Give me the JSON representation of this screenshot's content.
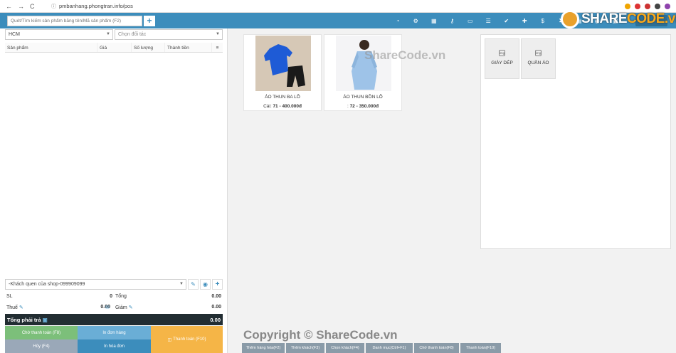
{
  "browser": {
    "url": "pmbanhang.phongtran.info/pos",
    "nav_back": "←",
    "nav_forward": "→",
    "nav_reload": "C",
    "lock": "ⓘ"
  },
  "toolbar": {
    "search_placeholder": "Quét/Tìm kiếm sản phẩm bằng tên/Mã sản phẩm (F2)",
    "add_label": "+",
    "icons": [
      "dashboard-icon",
      "share-icon",
      "calculator-icon",
      "key-icon",
      "laptop-icon",
      "list-icon",
      "check-circle-icon",
      "plus-circle-icon",
      "dollar-icon",
      "hourglass-icon",
      "calendar-icon",
      "bell-icon",
      "folder-icon"
    ],
    "icon_glyphs": [
      "◔",
      "⚙",
      "▦",
      "⚷",
      "▭",
      "☰",
      "✔",
      "✚",
      "$",
      "⧗",
      "▤",
      "◉",
      "▣"
    ]
  },
  "left": {
    "location_select": "HCM",
    "partner_select": "Chọn đối tác",
    "table_headers": [
      "Sản phẩm",
      "Giá",
      "Số lượng",
      "Thành tiền",
      "≡"
    ],
    "customer_select": "-Khách quen của shop-099909099",
    "customer_buttons": [
      "✎",
      "◉",
      "+"
    ],
    "summary": {
      "qty_label": "SL",
      "qty_value": "0",
      "subtotal_label": "Tổng",
      "subtotal_value": "0.00",
      "tax_label": "Thuế",
      "tax_value": "0.00",
      "discount_label": "Giảm",
      "discount_value": "0.00",
      "edit_glyph": "✎",
      "comment_glyph": "✉"
    },
    "total": {
      "label": "Tổng phải trả",
      "value": "0.00",
      "icon": "▣"
    },
    "actions": {
      "partial_pay": "Chờ thanh toán (F8)",
      "print_order": "In đơn hàng",
      "pay": "Thanh toán (F10)",
      "pay_icon": "◫",
      "cancel": "Hủy (F4)",
      "print_invoice": "In hóa đơn"
    },
    "colors": {
      "partial_pay": "#7cbf7a",
      "print_order": "#6aaed6",
      "pay": "#f5b547",
      "cancel": "#9aa8b8",
      "print_invoice": "#3c8dbc"
    }
  },
  "products": [
    {
      "name": "ÁO THUN BA LỖ",
      "price_prefix": "Cái:",
      "price_value": "71 - 400.000đ"
    },
    {
      "name": "ÁO THUN BỒN LỖ",
      "price_prefix": ":",
      "price_value": "72 - 350.000đ"
    }
  ],
  "categories": [
    {
      "name": "GIÀY DÉP",
      "icon": "img"
    },
    {
      "name": "QUẦN ÁO",
      "icon": "img"
    }
  ],
  "bottom_tabs": [
    "Thêm hàng hóa(F2)",
    "Thêm khách(F3)",
    "Chọn khách(F4)",
    "Danh mục(Ctrl+F1)",
    "Chờ thanh toán(F8)",
    "Thanh toán(F10)"
  ],
  "watermarks": {
    "logo_main": "SHARE",
    "logo_accent": "CODE.vn",
    "middle": "ShareCode.vn",
    "bottom": "Copyright © ShareCode.vn"
  }
}
